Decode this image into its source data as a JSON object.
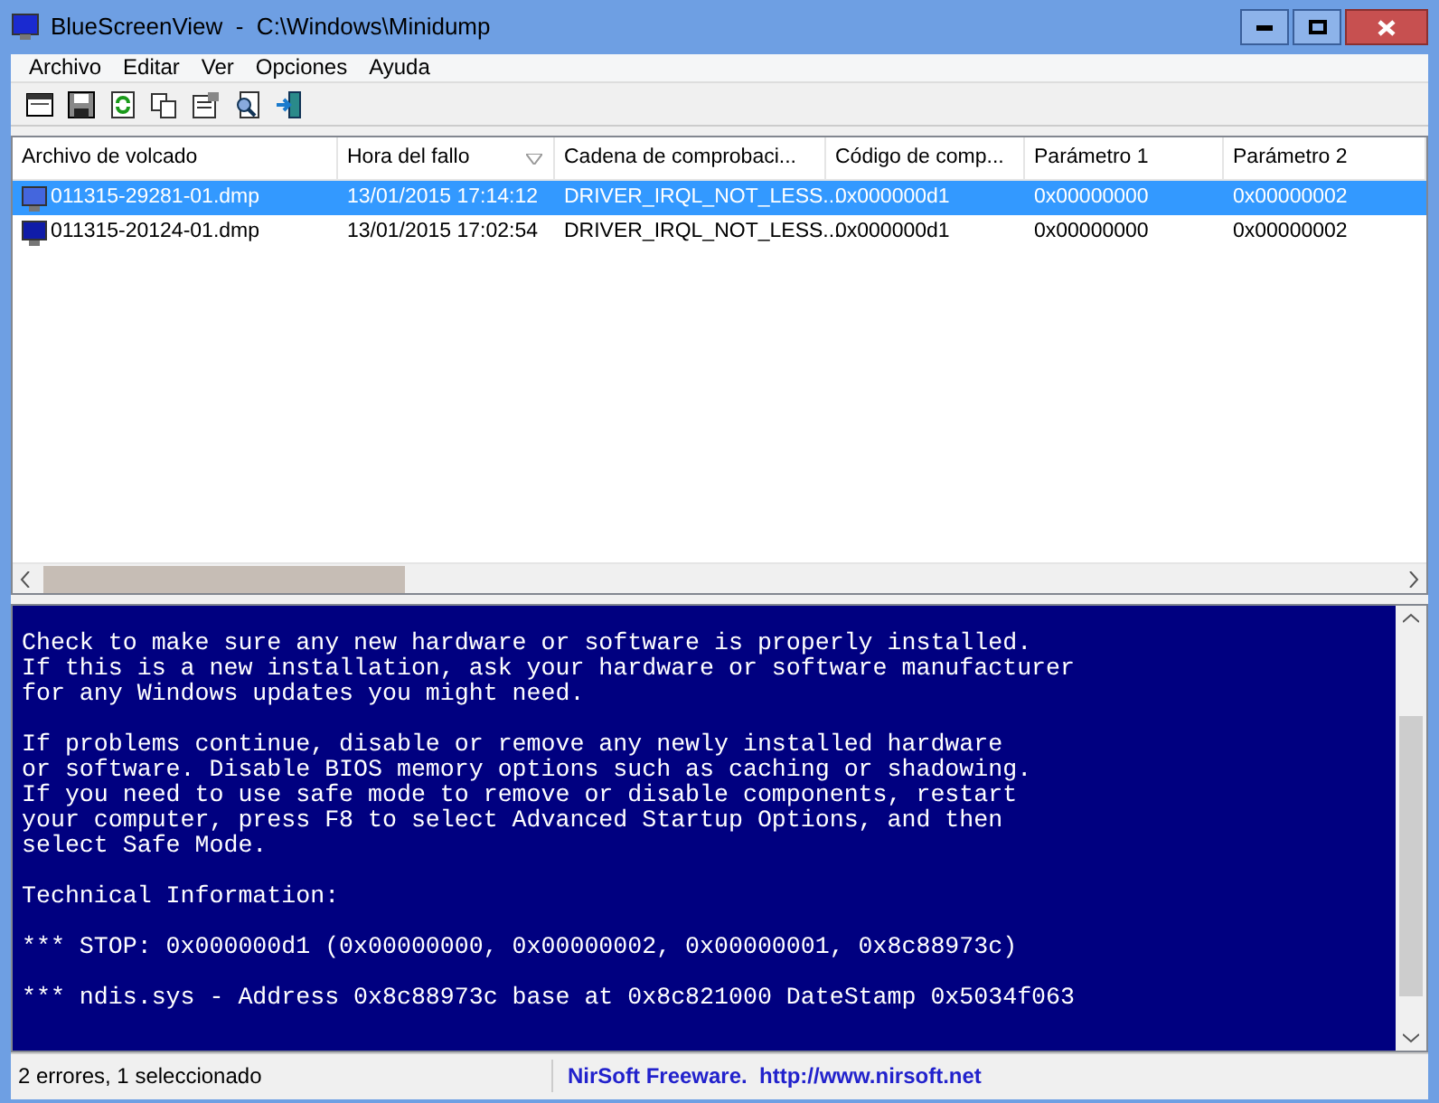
{
  "window": {
    "title": "BlueScreenView  -  C:\\Windows\\Minidump"
  },
  "menu": [
    "Archivo",
    "Editar",
    "Ver",
    "Opciones",
    "Ayuda"
  ],
  "toolbar": [
    {
      "kind": "window"
    },
    {
      "kind": "save"
    },
    {
      "kind": "refresh"
    },
    {
      "kind": "copy"
    },
    {
      "kind": "properties"
    },
    {
      "kind": "find"
    },
    {
      "kind": "exit"
    }
  ],
  "table": {
    "columns": [
      {
        "label": "Archivo de volcado",
        "sorted": false
      },
      {
        "label": "Hora del fallo",
        "sorted": true
      },
      {
        "label": "Cadena de comprobaci...",
        "sorted": false
      },
      {
        "label": "Código de comp...",
        "sorted": false
      },
      {
        "label": "Parámetro 1",
        "sorted": false
      },
      {
        "label": "Parámetro 2",
        "sorted": false
      }
    ],
    "rows": [
      {
        "selected": true,
        "cells": [
          "011315-29281-01.dmp",
          "13/01/2015 17:14:12",
          "DRIVER_IRQL_NOT_LESS...",
          "0x000000d1",
          "0x00000000",
          "0x00000002"
        ]
      },
      {
        "selected": false,
        "cells": [
          "011315-20124-01.dmp",
          "13/01/2015 17:02:54",
          "DRIVER_IRQL_NOT_LESS...",
          "0x000000d1",
          "0x00000000",
          "0x00000002"
        ]
      }
    ]
  },
  "report": [
    [
      "Check to make sure any new hardware or software is properly installed.",
      "If this is a new installation, ask your hardware or software manufacturer",
      "for any Windows updates you might need."
    ],
    [
      "If problems continue, disable or remove any newly installed hardware",
      "or software. Disable BIOS memory options such as caching or shadowing.",
      "If you need to use safe mode to remove or disable components, restart",
      "your computer, press F8 to select Advanced Startup Options, and then",
      "select Safe Mode."
    ],
    [
      "Technical Information:"
    ],
    [
      "*** STOP: 0x000000d1 (0x00000000, 0x00000002, 0x00000001, 0x8c88973c)"
    ],
    [
      "*** ndis.sys - Address 0x8c88973c base at 0x8c821000 DateStamp 0x5034f063"
    ]
  ],
  "status_bar": {
    "summary": "2 errores, 1 seleccionado",
    "credit": "NirSoft Freeware.  http://www.nirsoft.net"
  }
}
